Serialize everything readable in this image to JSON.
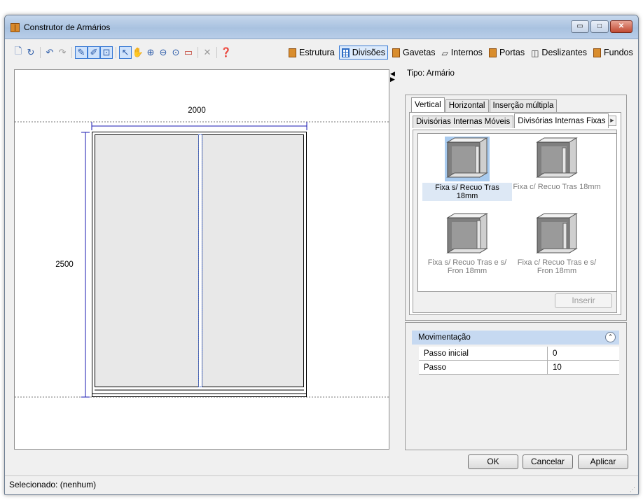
{
  "window": {
    "title": "Construtor de Armários",
    "controls": {
      "minimize": "▭",
      "maximize": "□",
      "close": "✕"
    }
  },
  "toolbar": {
    "icons": [
      "new-icon",
      "refresh-icon",
      "undo-icon",
      "redo-icon",
      "pencil-select-icon",
      "pencil-erase-icon",
      "measure-icon",
      "pointer-icon",
      "hand-pan-icon",
      "zoom-in-icon",
      "zoom-out-icon",
      "zoom-fit-icon",
      "zoom-window-icon",
      "delete-icon",
      "help-icon"
    ],
    "buttons": {
      "estrutura": "Estrutura",
      "divisoes": "Divisões",
      "gavetas": "Gavetas",
      "internos": "Internos",
      "portas": "Portas",
      "deslizantes": "Deslizantes",
      "fundos": "Fundos"
    },
    "active": "Divisões"
  },
  "drawing": {
    "width_label": "2000",
    "height_label": "2500",
    "colors": {
      "dimension": "#1a1ab0",
      "panel": "#e8e8e8",
      "divider": "#2f56c8"
    }
  },
  "side_panel": {
    "tipo": "Tipo: Armário",
    "tabs": [
      "Vertical",
      "Horizontal",
      "Inserção múltipla"
    ],
    "active_tab": "Vertical",
    "subtabs": [
      "Divisórias Internas Móveis",
      "Divisórias Internas Fixas"
    ],
    "active_subtab": "Divisórias Internas Fixas",
    "items": [
      {
        "label": "Fixa s/ Recuo Tras 18mm",
        "selected": true
      },
      {
        "label": "Fixa c/ Recuo Tras 18mm",
        "selected": false
      },
      {
        "label": "Fixa s/ Recuo Tras e s/ Fron 18mm",
        "selected": false
      },
      {
        "label": "Fixa c/ Recuo Tras e s/ Fron 18mm",
        "selected": false
      }
    ],
    "inserir": "Inserir"
  },
  "properties": {
    "group": "Movimentação",
    "rows": [
      {
        "key": "Passo inicial",
        "value": "0"
      },
      {
        "key": "Passo",
        "value": "10"
      }
    ]
  },
  "dialog": {
    "ok": "OK",
    "cancel": "Cancelar",
    "apply": "Aplicar"
  },
  "status": {
    "text": "Selecionado: (nenhum)"
  }
}
